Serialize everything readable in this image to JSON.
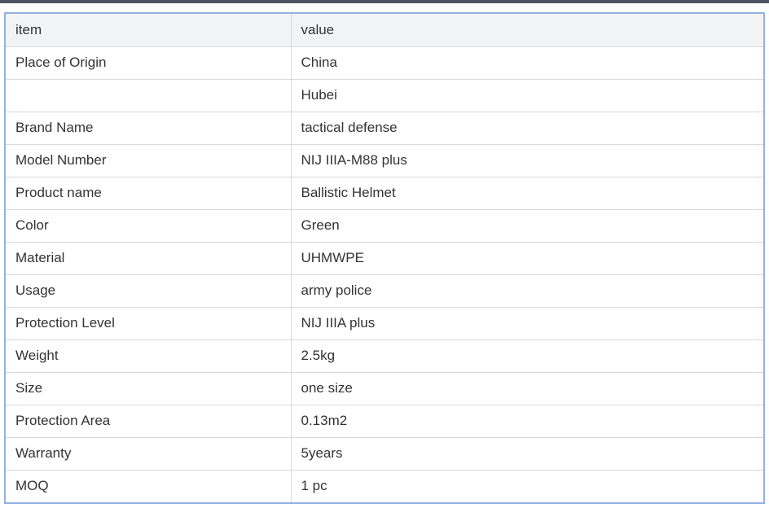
{
  "table": {
    "headers": {
      "item": "item",
      "value": "value"
    },
    "rows": [
      {
        "item": "Place of Origin",
        "value": "China"
      },
      {
        "item": "",
        "value": "Hubei"
      },
      {
        "item": "Brand Name",
        "value": "tactical defense"
      },
      {
        "item": "Model Number",
        "value": "NIJ IIIA-M88 plus"
      },
      {
        "item": "Product name",
        "value": "Ballistic Helmet"
      },
      {
        "item": "Color",
        "value": "Green"
      },
      {
        "item": "Material",
        "value": "UHMWPE"
      },
      {
        "item": "Usage",
        "value": "army police"
      },
      {
        "item": "Protection Level",
        "value": "NIJ IIIA plus"
      },
      {
        "item": "Weight",
        "value": "2.5kg"
      },
      {
        "item": "Size",
        "value": "one size"
      },
      {
        "item": "Protection Area",
        "value": "0.13m2"
      },
      {
        "item": "Warranty",
        "value": "5years"
      },
      {
        "item": "MOQ",
        "value": "1 pc"
      }
    ]
  },
  "colors": {
    "top_rule": "#4e5561",
    "frame_border": "#93b2e0",
    "header_bg": "#f2f3f5",
    "cell_border": "#d9d9d9",
    "text": "#333333"
  }
}
